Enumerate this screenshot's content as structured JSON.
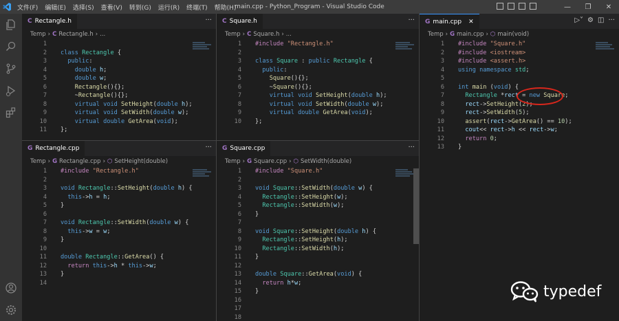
{
  "titlebar": {
    "menu": [
      "文件(F)",
      "编辑(E)",
      "选择(S)",
      "查看(V)",
      "转到(G)",
      "运行(R)",
      "终端(T)",
      "帮助(H)"
    ],
    "title": "main.cpp - Python_Program - Visual Studio Code"
  },
  "colors": {
    "accent": "#3794ff",
    "annotation": "#d9271c",
    "editor_bg": "#1e1e1e"
  },
  "panes": {
    "rect_h": {
      "tab": "Rectangle.h",
      "crumbs": [
        "Temp",
        "Rectangle.h",
        "..."
      ],
      "lines": [
        {
          "n": "1",
          "html": ""
        },
        {
          "n": "2",
          "html": "<span class='kw'>class</span> <span class='ty'>Rectangle</span> {"
        },
        {
          "n": "3",
          "html": "  <span class='kw'>public</span>:"
        },
        {
          "n": "4",
          "html": "    <span class='kw'>double</span> <span class='var'>h</span>;"
        },
        {
          "n": "5",
          "html": "    <span class='kw'>double</span> <span class='var'>w</span>;"
        },
        {
          "n": "6",
          "html": "    <span class='fn'>Rectangle</span>(){};"
        },
        {
          "n": "7",
          "html": "    ~<span class='fn'>Rectangle</span>(){};"
        },
        {
          "n": "8",
          "html": "    <span class='kw'>virtual</span> <span class='kw'>void</span> <span class='fn'>SetHeight</span>(<span class='kw'>double</span> <span class='var'>h</span>);"
        },
        {
          "n": "9",
          "html": "    <span class='kw'>virtual</span> <span class='kw'>void</span> <span class='fn'>SetWidth</span>(<span class='kw'>double</span> <span class='var'>w</span>);"
        },
        {
          "n": "10",
          "html": "    <span class='kw'>virtual</span> <span class='kw'>double</span> <span class='fn'>GetArea</span>(<span class='kw'>void</span>);"
        },
        {
          "n": "11",
          "html": "};"
        }
      ]
    },
    "square_h": {
      "tab": "Square.h",
      "crumbs": [
        "Temp",
        "Square.h",
        "..."
      ],
      "lines": [
        {
          "n": "1",
          "html": "<span class='pp'>#include</span> <span class='str'>\"Rectangle.h\"</span>"
        },
        {
          "n": "2",
          "html": ""
        },
        {
          "n": "3",
          "html": "<span class='kw'>class</span> <span class='ty'>Square</span> : <span class='kw'>public</span> <span class='ty'>Rectangle</span> {"
        },
        {
          "n": "4",
          "html": "  <span class='kw'>public</span>:"
        },
        {
          "n": "5",
          "html": "    <span class='fn'>Square</span>(){};"
        },
        {
          "n": "6",
          "html": "    ~<span class='fn'>Square</span>(){};"
        },
        {
          "n": "7",
          "html": "    <span class='kw'>virtual</span> <span class='kw'>void</span> <span class='fn'>SetHeight</span>(<span class='kw'>double</span> <span class='var'>h</span>);"
        },
        {
          "n": "8",
          "html": "    <span class='kw'>virtual</span> <span class='kw'>void</span> <span class='fn'>SetWidth</span>(<span class='kw'>double</span> <span class='var'>w</span>);"
        },
        {
          "n": "9",
          "html": "    <span class='kw'>virtual</span> <span class='kw'>double</span> <span class='fn'>GetArea</span>(<span class='kw'>void</span>);"
        },
        {
          "n": "10",
          "html": "};"
        }
      ]
    },
    "main_cpp": {
      "tab": "main.cpp",
      "crumbs": [
        "Temp",
        "main.cpp",
        "main(void)"
      ],
      "lines": [
        {
          "n": "1",
          "html": "<span class='pp'>#include</span> <span class='str'>\"Square.h\"</span>"
        },
        {
          "n": "2",
          "html": "<span class='pp'>#include</span> <span class='str'>&lt;iostream&gt;</span>"
        },
        {
          "n": "3",
          "html": "<span class='pp'>#include</span> <span class='str'>&lt;assert.h&gt;</span>"
        },
        {
          "n": "4",
          "html": "<span class='kw'>using</span> <span class='kw'>namespace</span> <span class='ty'>std</span>;"
        },
        {
          "n": "5",
          "html": ""
        },
        {
          "n": "6",
          "html": "<span class='kw'>int</span> <span class='fn'>main</span> (<span class='kw'>void</span>) {"
        },
        {
          "n": "7",
          "html": "  <span class='ty'>Rectangle</span> *<span class='var'>rect</span> = <span class='kw'>new</span> <span class='fn'>Square</span>;"
        },
        {
          "n": "8",
          "html": "  <span class='var'>rect</span>-&gt;<span class='fn'>SetHeight</span>(<span class='num'>2</span>);"
        },
        {
          "n": "9",
          "html": "  <span class='var'>rect</span>-&gt;<span class='fn'>SetWidth</span>(<span class='num'>5</span>);"
        },
        {
          "n": "10",
          "html": "  <span class='fn'>assert</span>(<span class='var'>rect</span>-&gt;<span class='fn'>GetArea</span>() == <span class='num'>10</span>);"
        },
        {
          "n": "11",
          "html": "  <span class='var'>cout</span>&lt;&lt; <span class='var'>rect</span>-&gt;<span class='var'>h</span> &lt;&lt; <span class='var'>rect</span>-&gt;<span class='var'>w</span>;"
        },
        {
          "n": "12",
          "html": "  <span class='pp'>return</span> <span class='num'>0</span>;"
        },
        {
          "n": "13",
          "html": "}"
        }
      ]
    },
    "rect_cpp": {
      "tab": "Rectangle.cpp",
      "crumbs": [
        "Temp",
        "Rectangle.cpp",
        "SetHeight(double)"
      ],
      "lines": [
        {
          "n": "1",
          "html": "<span class='pp'>#include</span> <span class='str'>\"Rectangle.h\"</span>"
        },
        {
          "n": "2",
          "html": ""
        },
        {
          "n": "3",
          "html": "<span class='kw'>void</span> <span class='ty'>Rectangle</span>::<span class='fn'>SetHeight</span>(<span class='kw'>double</span> <span class='var'>h</span>) {"
        },
        {
          "n": "4",
          "html": "  <span class='kw'>this</span>-&gt;<span class='var'>h</span> = <span class='var'>h</span>;"
        },
        {
          "n": "5",
          "html": "}"
        },
        {
          "n": "6",
          "html": ""
        },
        {
          "n": "7",
          "html": "<span class='kw'>void</span> <span class='ty'>Rectangle</span>::<span class='fn'>SetWidth</span>(<span class='kw'>double</span> <span class='var'>w</span>) {"
        },
        {
          "n": "8",
          "html": "  <span class='kw'>this</span>-&gt;<span class='var'>w</span> = <span class='var'>w</span>;"
        },
        {
          "n": "9",
          "html": "}"
        },
        {
          "n": "10",
          "html": ""
        },
        {
          "n": "11",
          "html": "<span class='kw'>double</span> <span class='ty'>Rectangle</span>::<span class='fn'>GetArea</span>() {"
        },
        {
          "n": "12",
          "html": "  <span class='pp'>return</span> <span class='kw'>this</span>-&gt;<span class='var'>h</span> * <span class='kw'>this</span>-&gt;<span class='var'>w</span>;"
        },
        {
          "n": "13",
          "html": "}"
        },
        {
          "n": "14",
          "html": ""
        }
      ]
    },
    "square_cpp": {
      "tab": "Square.cpp",
      "crumbs": [
        "Temp",
        "Square.cpp",
        "SetWidth(double)"
      ],
      "lines": [
        {
          "n": "1",
          "html": "<span class='pp'>#include</span> <span class='str'>\"Square.h\"</span>"
        },
        {
          "n": "2",
          "html": ""
        },
        {
          "n": "3",
          "html": "<span class='kw'>void</span> <span class='ty'>Square</span>::<span class='fn'>SetWidth</span>(<span class='kw'>double</span> <span class='var'>w</span>) {"
        },
        {
          "n": "4",
          "html": "  <span class='ty'>Rectangle</span>::<span class='fn'>SetHeight</span>(<span class='var'>w</span>);"
        },
        {
          "n": "5",
          "html": "  <span class='ty'>Rectangle</span>::<span class='fn'>SetWidth</span>(<span class='var'>w</span>);"
        },
        {
          "n": "6",
          "html": "}"
        },
        {
          "n": "7",
          "html": ""
        },
        {
          "n": "8",
          "html": "<span class='kw'>void</span> <span class='ty'>Square</span>::<span class='fn'>SetHeight</span>(<span class='kw'>double</span> <span class='var'>h</span>) {"
        },
        {
          "n": "9",
          "html": "  <span class='ty'>Rectangle</span>::<span class='fn'>SetHeight</span>(<span class='var'>h</span>);"
        },
        {
          "n": "10",
          "html": "  <span class='ty'>Rectangle</span>::<span class='fn'>SetWidth</span>(<span class='var'>h</span>);"
        },
        {
          "n": "11",
          "html": "}"
        },
        {
          "n": "12",
          "html": ""
        },
        {
          "n": "13",
          "html": "<span class='kw'>double</span> <span class='ty'>Square</span>::<span class='fn'>GetArea</span>(<span class='kw'>void</span>) {"
        },
        {
          "n": "14",
          "html": "  <span class='pp'>return</span> <span class='var'>h</span>*<span class='var'>w</span>;"
        },
        {
          "n": "15",
          "html": "}"
        },
        {
          "n": "16",
          "html": ""
        },
        {
          "n": "17",
          "html": ""
        },
        {
          "n": "18",
          "html": ""
        }
      ]
    }
  },
  "watermark": {
    "text": "typedef",
    "icon": "wechat-icon"
  }
}
